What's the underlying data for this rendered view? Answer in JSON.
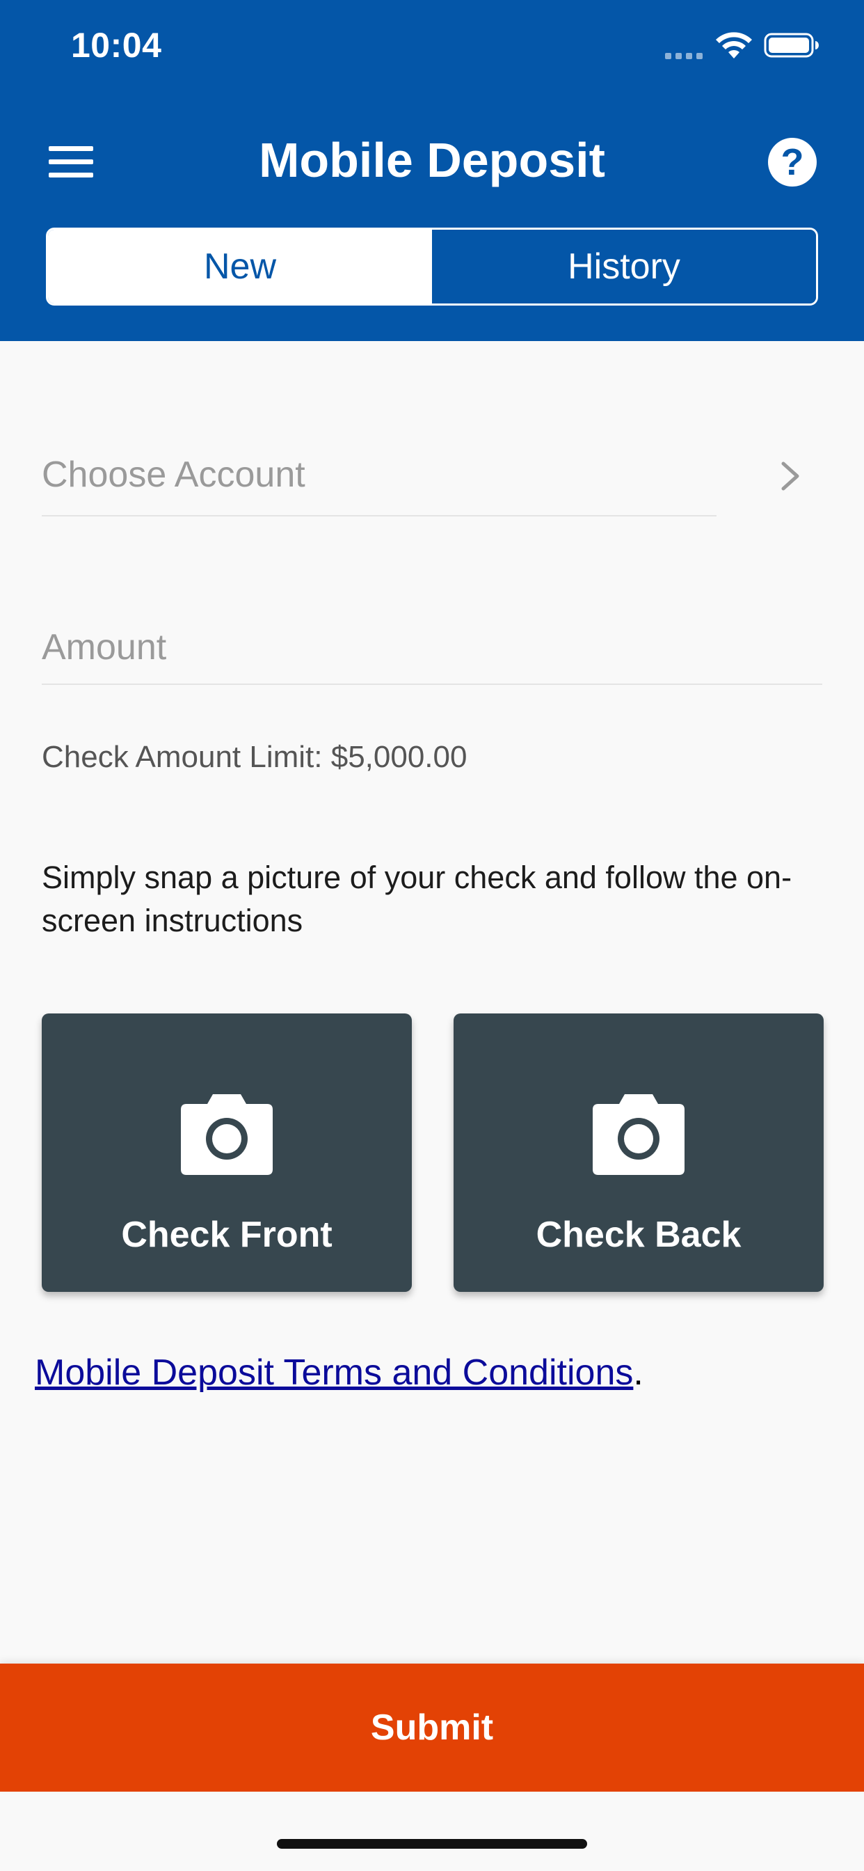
{
  "status_bar": {
    "time": "10:04"
  },
  "header": {
    "title": "Mobile Deposit",
    "menu_icon": "hamburger-menu-icon",
    "help_icon": "help-icon",
    "help_glyph": "?",
    "tabs": [
      {
        "label": "New",
        "active": true
      },
      {
        "label": "History",
        "active": false
      }
    ],
    "background_color": "#0456a8"
  },
  "form": {
    "account_placeholder": "Choose Account",
    "amount_placeholder": "Amount",
    "amount_value": "",
    "limit_text": "Check Amount Limit: $5,000.00",
    "instructions": "Simply snap a picture of your check and follow the on-screen instructions"
  },
  "capture": {
    "front_label": "Check Front",
    "back_label": "Check Back",
    "icon": "camera-icon",
    "card_color": "#37474f"
  },
  "terms": {
    "link_text": "Mobile Deposit Terms and Conditions",
    "suffix": "."
  },
  "submit": {
    "label": "Submit",
    "color": "#e34205"
  }
}
